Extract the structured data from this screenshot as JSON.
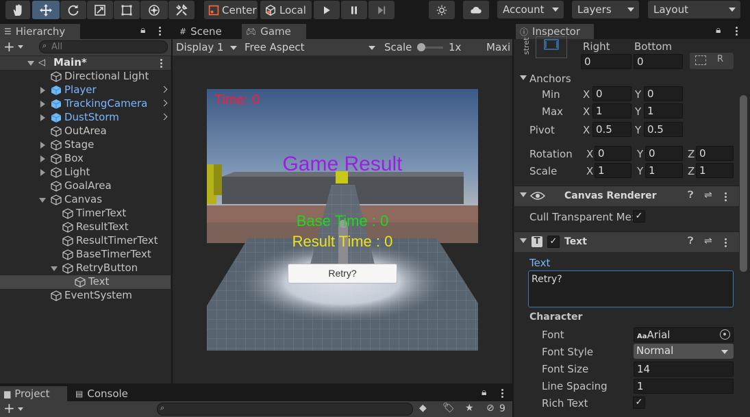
{
  "toolbar": {
    "pivot_label": "Center",
    "space_label": "Local",
    "account_label": "Account",
    "layers_label": "Layers",
    "layout_label": "Layout"
  },
  "hierarchy": {
    "tab_label": "Hierarchy",
    "search_placeholder": "All",
    "scene_name": "Main*",
    "items": [
      {
        "label": "Directional Light"
      },
      {
        "label": "Player"
      },
      {
        "label": "TrackingCamera"
      },
      {
        "label": "DustStorm"
      },
      {
        "label": "OutArea"
      },
      {
        "label": "Stage"
      },
      {
        "label": "Box"
      },
      {
        "label": "Light"
      },
      {
        "label": "GoalArea"
      },
      {
        "label": "Canvas"
      },
      {
        "label": "TimerText"
      },
      {
        "label": "ResultText"
      },
      {
        "label": "ResultTimerText"
      },
      {
        "label": "BaseTimerText"
      },
      {
        "label": "RetryButton"
      },
      {
        "label": "Text"
      },
      {
        "label": "EventSystem"
      }
    ]
  },
  "game": {
    "scene_tab": "Scene",
    "game_tab": "Game",
    "display": "Display 1",
    "aspect": "Free Aspect",
    "scale_label": "Scale",
    "scale_value": "1x",
    "maximize_label": "Maxi",
    "time_text": "Time: 0",
    "result_title": "Game Result",
    "base_time_text": "Base Time : 0",
    "result_time_text": "Result Time : 0",
    "retry_label": "Retry?"
  },
  "inspector": {
    "tab_label": "Inspector",
    "stretch_label": "stret",
    "right_label": "Right",
    "bottom_label": "Bottom",
    "right_value": "0",
    "bottom_value": "0",
    "anchors_label": "Anchors",
    "min_label": "Min",
    "max_label": "Max",
    "min_x": "0",
    "min_y": "0",
    "max_x": "1",
    "max_y": "1",
    "pivot_label": "Pivot",
    "pivot_x": "0.5",
    "pivot_y": "0.5",
    "rotation_label": "Rotation",
    "rot_x": "0",
    "rot_y": "0",
    "rot_z": "0",
    "scale_label": "Scale",
    "scale_x": "1",
    "scale_y": "1",
    "scale_z": "1",
    "x_label": "X",
    "y_label": "Y",
    "z_label": "Z",
    "canvas_renderer_title": "Canvas Renderer",
    "cull_label": "Cull Transparent Me:",
    "text_component_title": "Text",
    "text_label": "Text",
    "text_value": "Retry?",
    "character_label": "Character",
    "font_label": "Font",
    "font_value": "Arial",
    "font_prefix": "Aa",
    "font_style_label": "Font Style",
    "font_style_value": "Normal",
    "font_size_label": "Font Size",
    "font_size_value": "14",
    "line_spacing_label": "Line Spacing",
    "line_spacing_value": "1",
    "rich_text_label": "Rich Text"
  },
  "bottom": {
    "project_tab": "Project",
    "console_tab": "Console",
    "hidden_count": "9"
  },
  "colors": {
    "time_text": "#ff1a3c",
    "result_title": "#9b1fe0",
    "base_time": "#1ed81e",
    "result_time": "#f0e21a",
    "hierarchy_prefab": "#7ab7ff",
    "selected_tool": "#46607c"
  }
}
